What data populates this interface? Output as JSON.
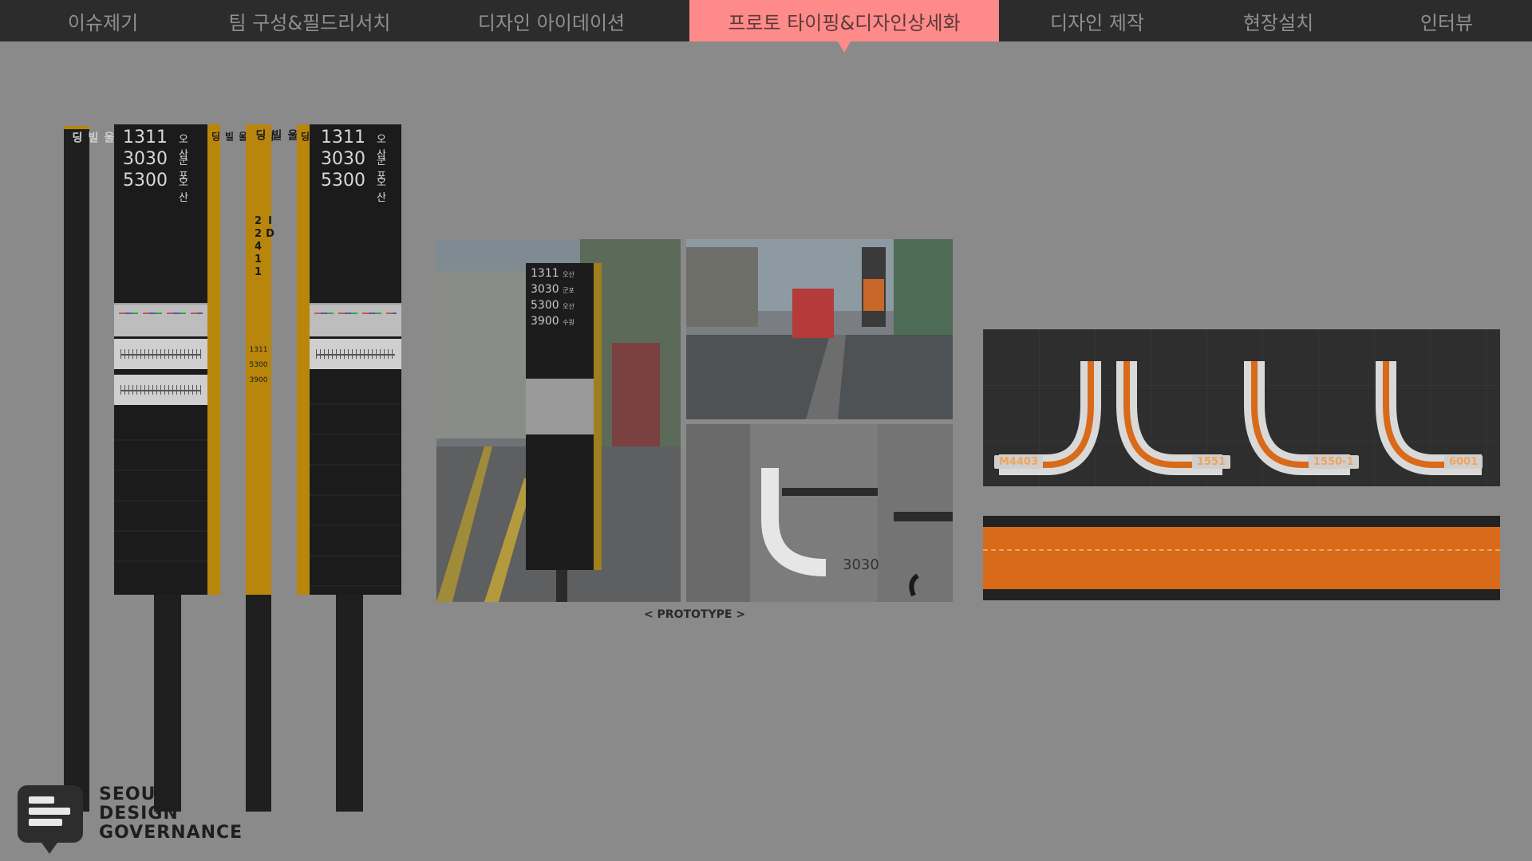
{
  "nav": {
    "tabs": [
      {
        "label": "이슈제기",
        "active": false
      },
      {
        "label": "팀 구성&필드리서치",
        "active": false
      },
      {
        "label": "디자인 아이데이션",
        "active": false
      },
      {
        "label": "프로토 타이핑&디자인상세화",
        "active": true
      },
      {
        "label": "디자인 제작",
        "active": false
      },
      {
        "label": "현장설치",
        "active": false
      },
      {
        "label": "인터뷰",
        "active": false
      }
    ]
  },
  "signs": {
    "stop_name": "남서울빌딩",
    "stop_id": "ID 22411",
    "routes": [
      {
        "number": "1311",
        "dest": "오산"
      },
      {
        "number": "3030",
        "dest": "군포"
      },
      {
        "number": "5300",
        "dest": "오산"
      }
    ],
    "small_routes": [
      "1311",
      "5300",
      "3900"
    ],
    "photo_routes": [
      {
        "number": "1311",
        "dest": "오산"
      },
      {
        "number": "3030",
        "dest": "군포"
      },
      {
        "number": "5300",
        "dest": "오산"
      },
      {
        "number": "3900",
        "dest": "수원"
      }
    ]
  },
  "prototype": {
    "caption": "< PROTOTYPE >",
    "floor_mark_label": "3030"
  },
  "floor": {
    "labels": [
      "M4403",
      "1551",
      "1550-1",
      "6001"
    ]
  },
  "colors": {
    "accent": "#ff8a8a",
    "sign_yellow": "#b8860b",
    "floor_orange": "#d86a1a"
  },
  "logo": {
    "line1": "SEOUL",
    "line2": "DESIGN",
    "line3": "GOVERNANCE"
  }
}
